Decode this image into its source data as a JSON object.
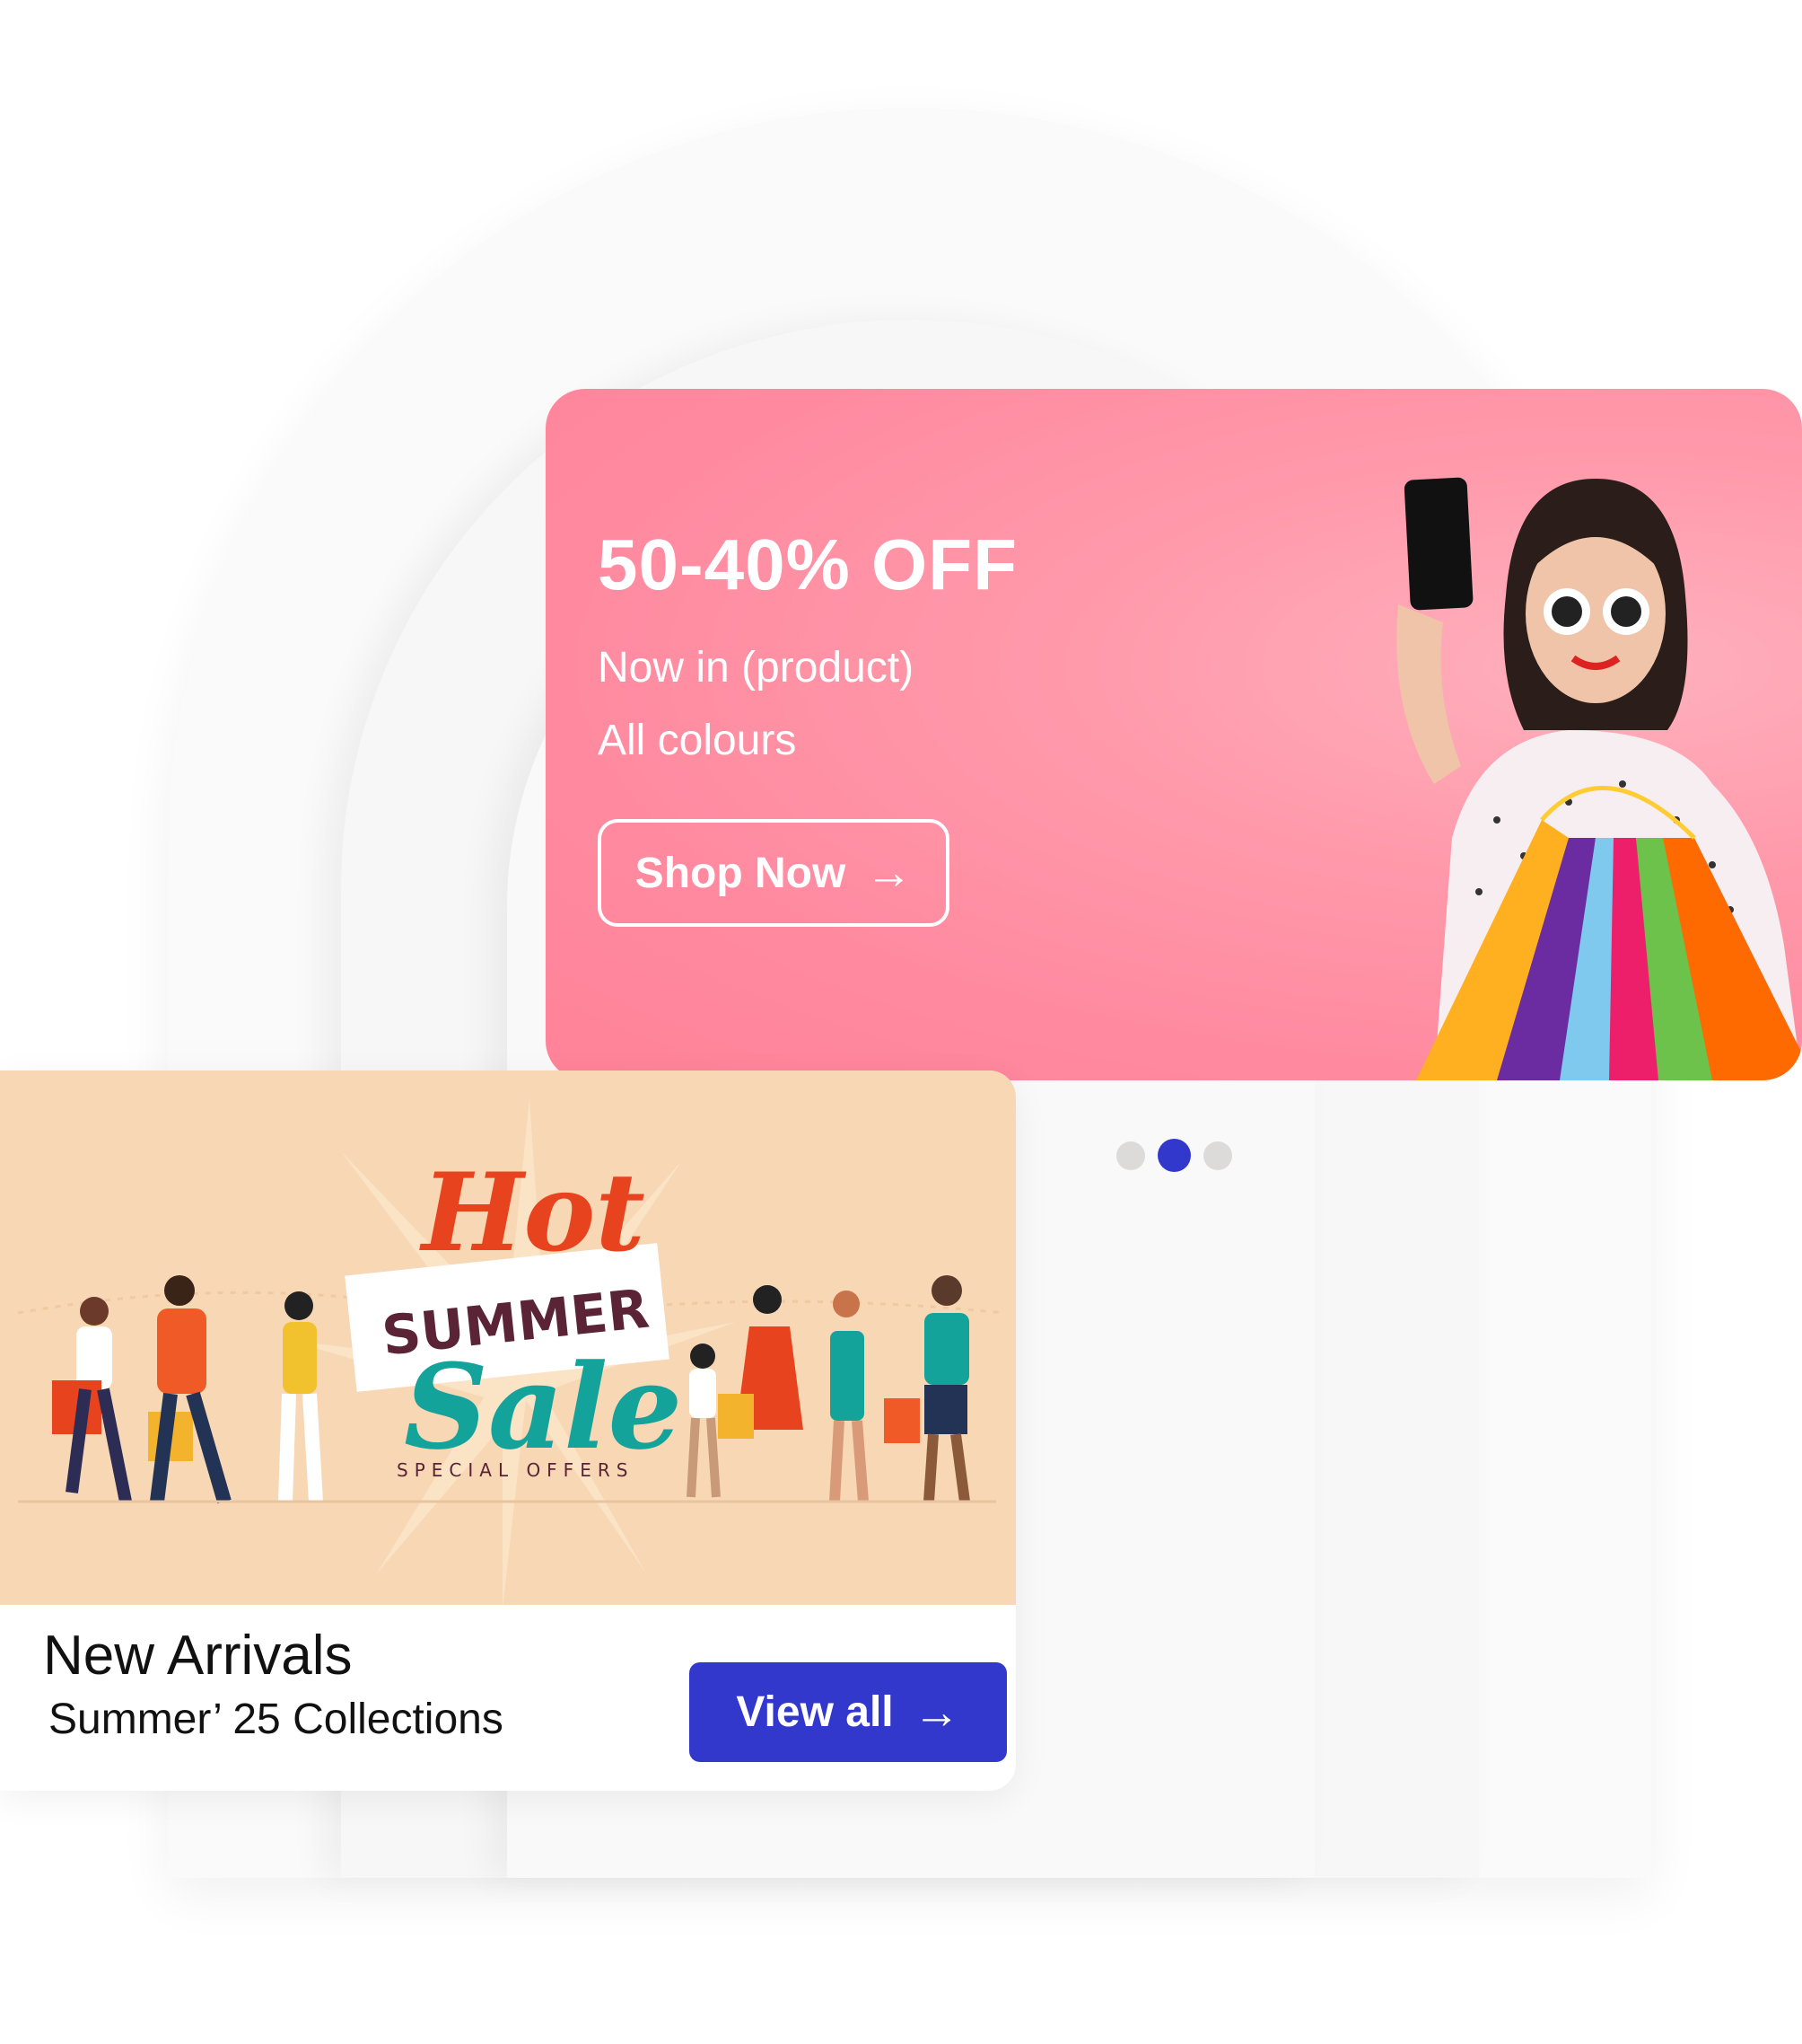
{
  "promo": {
    "headline": "50-40% OFF",
    "line1": "Now in (product)",
    "line2": "All colours",
    "cta_label": "Shop Now",
    "cta_icon": "arrow-right-icon",
    "background_color": "#ff8aa0"
  },
  "carousel": {
    "active_index": 1,
    "count": 3,
    "active_color": "#3338cc",
    "inactive_color": "#dcdbd9"
  },
  "sale_card": {
    "art": {
      "hot": "Hot",
      "summer": "SUMMER",
      "sale": "Sale",
      "special": "SPECIAL OFFERS"
    },
    "title": "New Arrivals",
    "subtitle": "Summer’ 25 Collections",
    "cta_label": "View all",
    "cta_icon": "arrow-right-icon",
    "cta_color": "#3338cc"
  }
}
